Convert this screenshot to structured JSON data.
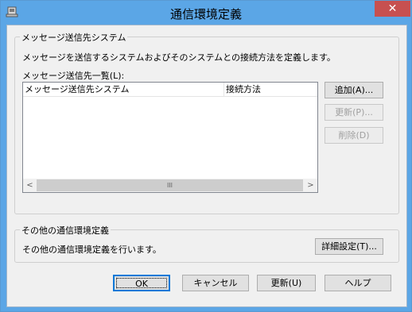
{
  "window": {
    "title": "通信環境定義",
    "close_glyph": "✕",
    "app_icon": "app-icon"
  },
  "group_system": {
    "legend": "メッセージ送信先システム",
    "description": "メッセージを送信するシステムおよびそのシステムとの接続方法を定義します。",
    "list_label": "メッセージ送信先一覧(L):",
    "columns": [
      "メッセージ送信先システム",
      "接続方法"
    ],
    "rows": [],
    "add_label": "追加(A)...",
    "update_label": "更新(P)...",
    "delete_label": "削除(D)"
  },
  "scrollbar": {
    "left_arrow": "<",
    "right_arrow": ">",
    "thumb_grip": "III"
  },
  "group_other": {
    "legend": "その他の通信環境定義",
    "description": "その他の通信環境定義を行います。",
    "detail_label": "詳細設定(T)..."
  },
  "footer": {
    "ok_label": "OK",
    "cancel_label": "キャンセル",
    "update_label": "更新(U)",
    "help_label": "ヘルプ"
  }
}
